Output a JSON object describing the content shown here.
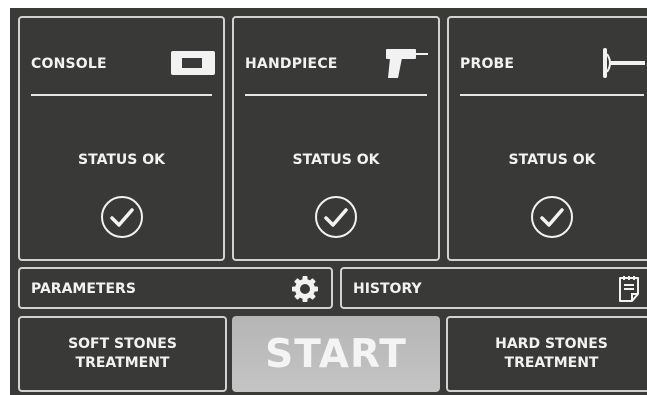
{
  "cards": [
    {
      "title": "CONSOLE",
      "status": "STATUS OK",
      "icon": "console-icon"
    },
    {
      "title": "HANDPIECE",
      "status": "STATUS OK",
      "icon": "handpiece-icon"
    },
    {
      "title": "PROBE",
      "status": "STATUS OK",
      "icon": "probe-icon"
    }
  ],
  "parameters": {
    "label": "PARAMETERS",
    "icon": "gear-icon"
  },
  "history": {
    "label": "HISTORY",
    "icon": "notepad-icon"
  },
  "buttons": {
    "soft_line1": "SOFT STONES",
    "soft_line2": "TREATMENT",
    "start": "START",
    "hard_line1": "HARD STONES",
    "hard_line2": "TREATMENT"
  },
  "colors": {
    "background": "#3a3a39",
    "border": "#d2d2d2",
    "start_button": "#bcbcbc",
    "text": "#f2f2f2"
  }
}
